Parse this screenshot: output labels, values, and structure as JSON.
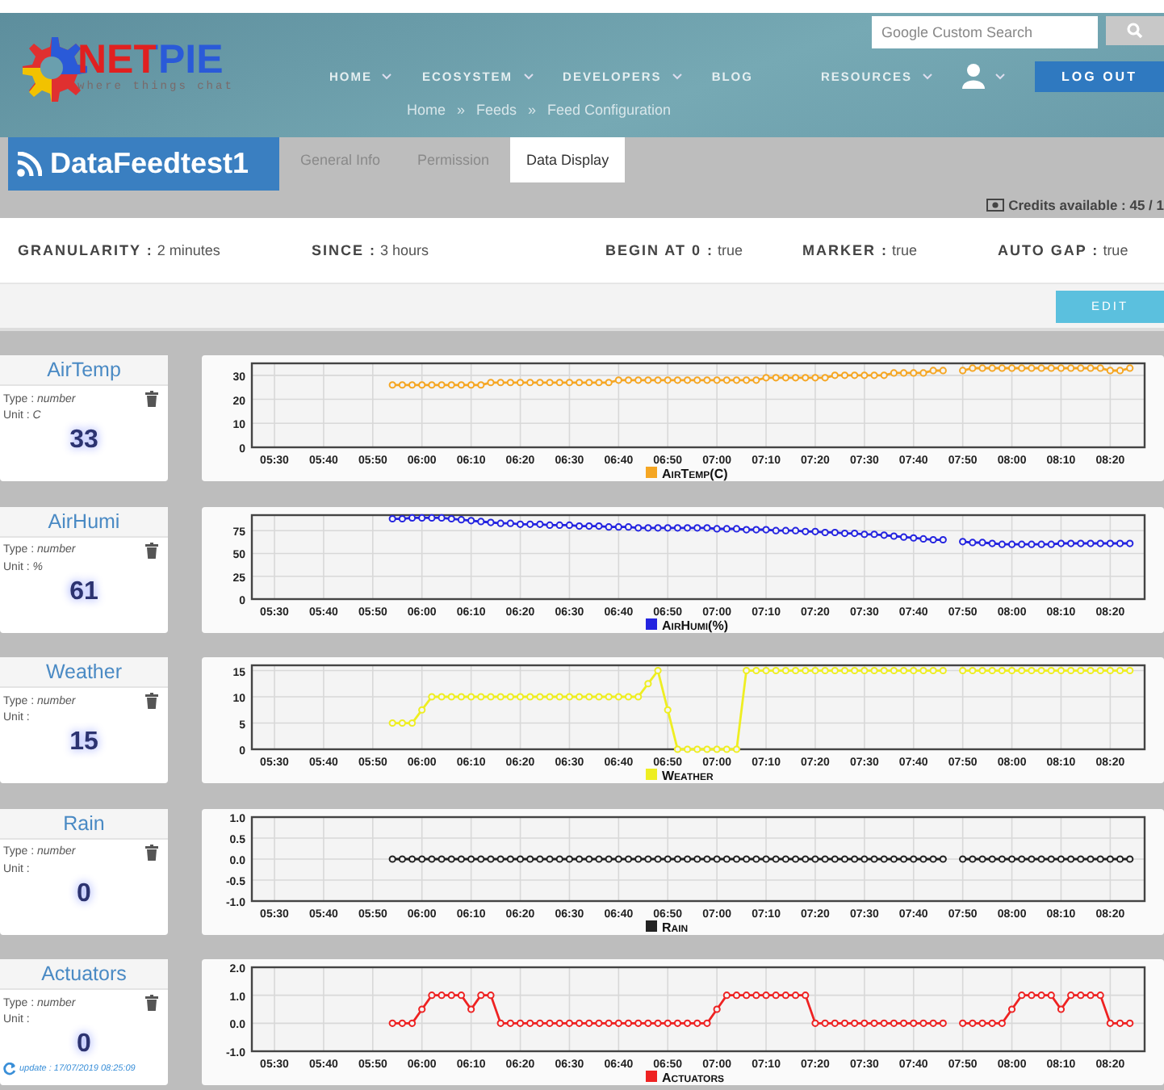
{
  "header": {
    "logo": {
      "name": "NETPIE",
      "tagline": "where things chat"
    },
    "search": {
      "placeholder": "Google Custom Search"
    },
    "nav": [
      {
        "label": "HOME",
        "dropdown": true
      },
      {
        "label": "ECOSYSTEM",
        "dropdown": true
      },
      {
        "label": "DEVELOPERS",
        "dropdown": true
      },
      {
        "label": "BLOG",
        "dropdown": false
      },
      {
        "label": "RESOURCES",
        "dropdown": true
      }
    ],
    "user_menu": {
      "dropdown": true
    },
    "logout": "LOG OUT",
    "breadcrumb": [
      "Home",
      "Feeds",
      "Feed Configuration"
    ],
    "separator": "»"
  },
  "feed": {
    "title": "DataFeedtest1",
    "tabs": [
      {
        "label": "General Info",
        "selected": false
      },
      {
        "label": "Permission",
        "selected": false
      },
      {
        "label": "Data Display",
        "selected": true
      }
    ]
  },
  "credits": "Credits available : 45 / 1",
  "settings": [
    "**GRANULARITY :** 2 minutes",
    "**SINCE :** 3 hours",
    "**BEGIN AT 0 :** true",
    "**MARKER :** true",
    "**AUTO GAP :** true"
  ],
  "edit_button": "EDIT",
  "feeds": [
    {
      "name": "AirTemp",
      "type": "Type : *number*",
      "unit": "Unit : *C*",
      "value": "33",
      "chart_data": {
        "type": "line",
        "grid": true,
        "ylim": [
          0,
          35
        ],
        "yticks": [
          0,
          10,
          20,
          30
        ],
        "categories": [
          null,
          null,
          null,
          "05:30",
          null,
          null,
          null,
          null,
          "05:40",
          null,
          null,
          null,
          null,
          "05:50",
          null,
          null,
          null,
          null,
          "06:00",
          null,
          null,
          null,
          null,
          "06:10",
          null,
          null,
          null,
          null,
          "06:20",
          null,
          null,
          null,
          null,
          "06:30",
          null,
          null,
          null,
          null,
          "06:40",
          null,
          null,
          null,
          null,
          "06:50",
          null,
          null,
          null,
          null,
          "07:00",
          null,
          null,
          null,
          null,
          "07:10",
          null,
          null,
          null,
          null,
          "07:20",
          null,
          null,
          null,
          null,
          "07:30",
          null,
          null,
          null,
          null,
          "07:40",
          null,
          null,
          null,
          null,
          "07:50",
          null,
          null,
          null,
          null,
          "08:00",
          null,
          null,
          null,
          null,
          "08:10",
          null,
          null,
          null,
          null,
          "08:20",
          null,
          null
        ],
        "series": [
          {
            "name": "AirTemp(C)",
            "color": "#f5a623",
            "marker": true,
            "values": [
              null,
              null,
              null,
              null,
              null,
              null,
              null,
              null,
              null,
              null,
              null,
              null,
              null,
              null,
              null,
              26,
              26,
              26,
              26,
              26,
              26,
              26,
              26,
              26,
              26,
              27,
              27,
              27,
              27,
              27,
              27,
              27,
              27,
              27,
              27,
              27,
              27,
              27,
              28,
              28,
              28,
              28,
              28,
              28,
              28,
              28,
              28,
              28,
              28,
              28,
              28,
              28,
              28,
              29,
              29,
              29,
              29,
              29,
              29,
              29,
              30,
              30,
              30,
              30,
              30,
              30,
              31,
              31,
              31,
              31,
              32,
              32,
              null,
              32,
              33,
              33,
              33,
              33,
              33,
              33,
              33,
              33,
              33,
              33,
              33,
              33,
              33,
              33,
              32,
              32,
              33
            ]
          }
        ]
      }
    },
    {
      "name": "AirHumi",
      "type": "Type : *number*",
      "unit": "Unit : *%*",
      "value": "61",
      "chart_data": {
        "type": "line",
        "grid": true,
        "ylim": [
          0,
          92
        ],
        "yticks": [
          0,
          25,
          50,
          75
        ],
        "categories": [
          null,
          null,
          null,
          "05:30",
          null,
          null,
          null,
          null,
          "05:40",
          null,
          null,
          null,
          null,
          "05:50",
          null,
          null,
          null,
          null,
          "06:00",
          null,
          null,
          null,
          null,
          "06:10",
          null,
          null,
          null,
          null,
          "06:20",
          null,
          null,
          null,
          null,
          "06:30",
          null,
          null,
          null,
          null,
          "06:40",
          null,
          null,
          null,
          null,
          "06:50",
          null,
          null,
          null,
          null,
          "07:00",
          null,
          null,
          null,
          null,
          "07:10",
          null,
          null,
          null,
          null,
          "07:20",
          null,
          null,
          null,
          null,
          "07:30",
          null,
          null,
          null,
          null,
          "07:40",
          null,
          null,
          null,
          null,
          "07:50",
          null,
          null,
          null,
          null,
          "08:00",
          null,
          null,
          null,
          null,
          "08:10",
          null,
          null,
          null,
          null,
          "08:20",
          null,
          null
        ],
        "series": [
          {
            "name": "AirHumi(%)",
            "color": "#2424e0",
            "marker": true,
            "values": [
              null,
              null,
              null,
              null,
              null,
              null,
              null,
              null,
              null,
              null,
              null,
              null,
              null,
              null,
              null,
              88,
              88,
              89,
              89,
              89,
              89,
              88,
              87,
              86,
              85,
              84,
              83,
              83,
              82,
              82,
              82,
              81,
              81,
              81,
              80,
              80,
              80,
              79,
              79,
              79,
              78,
              78,
              78,
              78,
              78,
              78,
              78,
              78,
              77,
              77,
              77,
              76,
              76,
              76,
              75,
              75,
              75,
              74,
              74,
              73,
              73,
              72,
              72,
              71,
              71,
              70,
              69,
              68,
              67,
              66,
              65,
              65,
              null,
              63,
              62,
              62,
              61,
              60,
              60,
              60,
              60,
              60,
              60,
              61,
              61,
              61,
              61,
              61,
              61,
              61,
              61
            ]
          }
        ]
      }
    },
    {
      "name": "Weather",
      "type": "Type : *number*",
      "unit": "Unit :",
      "value": "15",
      "chart_data": {
        "type": "line",
        "grid": true,
        "ylim": [
          0,
          16
        ],
        "yticks": [
          0,
          5,
          10,
          15
        ],
        "categories": [
          null,
          null,
          null,
          "05:30",
          null,
          null,
          null,
          null,
          "05:40",
          null,
          null,
          null,
          null,
          "05:50",
          null,
          null,
          null,
          null,
          "06:00",
          null,
          null,
          null,
          null,
          "06:10",
          null,
          null,
          null,
          null,
          "06:20",
          null,
          null,
          null,
          null,
          "06:30",
          null,
          null,
          null,
          null,
          "06:40",
          null,
          null,
          null,
          null,
          "06:50",
          null,
          null,
          null,
          null,
          "07:00",
          null,
          null,
          null,
          null,
          "07:10",
          null,
          null,
          null,
          null,
          "07:20",
          null,
          null,
          null,
          null,
          "07:30",
          null,
          null,
          null,
          null,
          "07:40",
          null,
          null,
          null,
          null,
          "07:50",
          null,
          null,
          null,
          null,
          "08:00",
          null,
          null,
          null,
          null,
          "08:10",
          null,
          null,
          null,
          null,
          "08:20",
          null,
          null
        ],
        "series": [
          {
            "name": "Weather",
            "color": "#eeee22",
            "marker": true,
            "values": [
              null,
              null,
              null,
              null,
              null,
              null,
              null,
              null,
              null,
              null,
              null,
              null,
              null,
              null,
              null,
              5,
              5,
              5,
              7.5,
              10,
              10,
              10,
              10,
              10,
              10,
              10,
              10,
              10,
              10,
              10,
              10,
              10,
              10,
              10,
              10,
              10,
              10,
              10,
              10,
              10,
              10,
              12.5,
              15,
              7.5,
              0,
              0,
              0,
              0,
              0,
              0,
              0,
              15,
              15,
              15,
              15,
              15,
              15,
              15,
              15,
              15,
              15,
              15,
              15,
              15,
              15,
              15,
              15,
              15,
              15,
              15,
              15,
              15,
              null,
              15,
              15,
              15,
              15,
              15,
              15,
              15,
              15,
              15,
              15,
              15,
              15,
              15,
              15,
              15,
              15,
              15,
              15
            ]
          }
        ]
      }
    },
    {
      "name": "Rain",
      "type": "Type : *number*",
      "unit": "Unit :",
      "value": "0",
      "chart_data": {
        "type": "line",
        "grid": true,
        "ylim": [
          -1,
          1
        ],
        "yticks": [
          {
            "value": -1,
            "label": "-1.0"
          },
          {
            "value": -0.5,
            "label": "-0.5"
          },
          {
            "value": 0,
            "label": "0.0"
          },
          {
            "value": 0.5,
            "label": "0.5"
          },
          {
            "value": 1,
            "label": "1.0"
          }
        ],
        "categories": [
          null,
          null,
          null,
          "05:30",
          null,
          null,
          null,
          null,
          "05:40",
          null,
          null,
          null,
          null,
          "05:50",
          null,
          null,
          null,
          null,
          "06:00",
          null,
          null,
          null,
          null,
          "06:10",
          null,
          null,
          null,
          null,
          "06:20",
          null,
          null,
          null,
          null,
          "06:30",
          null,
          null,
          null,
          null,
          "06:40",
          null,
          null,
          null,
          null,
          "06:50",
          null,
          null,
          null,
          null,
          "07:00",
          null,
          null,
          null,
          null,
          "07:10",
          null,
          null,
          null,
          null,
          "07:20",
          null,
          null,
          null,
          null,
          "07:30",
          null,
          null,
          null,
          null,
          "07:40",
          null,
          null,
          null,
          null,
          "07:50",
          null,
          null,
          null,
          null,
          "08:00",
          null,
          null,
          null,
          null,
          "08:10",
          null,
          null,
          null,
          null,
          "08:20",
          null,
          null
        ],
        "series": [
          {
            "name": "Rain",
            "color": "#222222",
            "marker": true,
            "values": [
              null,
              null,
              null,
              null,
              null,
              null,
              null,
              null,
              null,
              null,
              null,
              null,
              null,
              null,
              null,
              0,
              0,
              0,
              0,
              0,
              0,
              0,
              0,
              0,
              0,
              0,
              0,
              0,
              0,
              0,
              0,
              0,
              0,
              0,
              0,
              0,
              0,
              0,
              0,
              0,
              0,
              0,
              0,
              0,
              0,
              0,
              0,
              0,
              0,
              0,
              0,
              0,
              0,
              0,
              0,
              0,
              0,
              0,
              0,
              0,
              0,
              0,
              0,
              0,
              0,
              0,
              0,
              0,
              0,
              0,
              0,
              0,
              null,
              0,
              0,
              0,
              0,
              0,
              0,
              0,
              0,
              0,
              0,
              0,
              0,
              0,
              0,
              0,
              0,
              0,
              0
            ]
          }
        ]
      }
    },
    {
      "name": "Actuators",
      "type": "Type : *number*",
      "unit": "Unit :",
      "value": "0",
      "update": "update : 17/07/2019 08:25:09",
      "chart_data": {
        "type": "line",
        "grid": true,
        "ylim": [
          -1,
          2
        ],
        "yticks": [
          {
            "value": -1,
            "label": "-1.0"
          },
          {
            "value": 0,
            "label": "0.0"
          },
          {
            "value": 1,
            "label": "1.0"
          },
          {
            "value": 2,
            "label": "2.0"
          }
        ],
        "categories": [
          null,
          null,
          null,
          "05:30",
          null,
          null,
          null,
          null,
          "05:40",
          null,
          null,
          null,
          null,
          "05:50",
          null,
          null,
          null,
          null,
          "06:00",
          null,
          null,
          null,
          null,
          "06:10",
          null,
          null,
          null,
          null,
          "06:20",
          null,
          null,
          null,
          null,
          "06:30",
          null,
          null,
          null,
          null,
          "06:40",
          null,
          null,
          null,
          null,
          "06:50",
          null,
          null,
          null,
          null,
          "07:00",
          null,
          null,
          null,
          null,
          "07:10",
          null,
          null,
          null,
          null,
          "07:20",
          null,
          null,
          null,
          null,
          "07:30",
          null,
          null,
          null,
          null,
          "07:40",
          null,
          null,
          null,
          null,
          "07:50",
          null,
          null,
          null,
          null,
          "08:00",
          null,
          null,
          null,
          null,
          "08:10",
          null,
          null,
          null,
          null,
          "08:20",
          null,
          null
        ],
        "series": [
          {
            "name": "Actuators",
            "color": "#ee2222",
            "marker": true,
            "values": [
              null,
              null,
              null,
              null,
              null,
              null,
              null,
              null,
              null,
              null,
              null,
              null,
              null,
              null,
              null,
              0,
              0,
              0,
              0.5,
              1,
              1,
              1,
              1,
              0.5,
              1,
              1,
              0,
              0,
              0,
              0,
              0,
              0,
              0,
              0,
              0,
              0,
              0,
              0,
              0,
              0,
              0,
              0,
              0,
              0,
              0,
              0,
              0,
              0,
              0.5,
              1,
              1,
              1,
              1,
              1,
              1,
              1,
              1,
              1,
              0,
              0,
              0,
              0,
              0,
              0,
              0,
              0,
              0,
              0,
              0,
              0,
              0,
              0,
              null,
              0,
              0,
              0,
              0,
              0,
              0.5,
              1,
              1,
              1,
              1,
              0.5,
              1,
              1,
              1,
              1,
              0,
              0,
              0
            ]
          }
        ]
      }
    }
  ]
}
